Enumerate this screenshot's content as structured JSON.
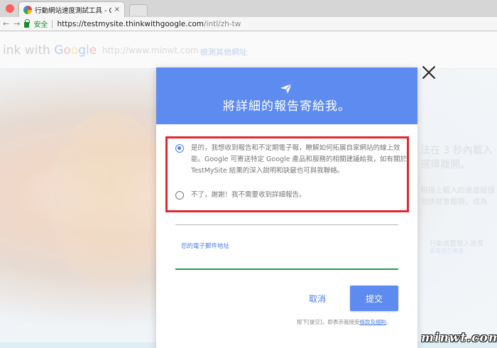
{
  "browser": {
    "tab_title": "行動網站速度測試工具 - Google",
    "tab_close": "×",
    "back": "←",
    "forward": "→",
    "secure_label": "安全",
    "url_host": "https://testmysite.thinkwithgoogle.com",
    "url_path": "/intl/zh-tw"
  },
  "page": {
    "brand_prefix": "ink with ",
    "brand_google": [
      "G",
      "o",
      "o",
      "g",
      "l",
      "e"
    ],
    "site_url": "http://www.minwt.com",
    "test_other": "檢測其他網址",
    "bg_lines": [
      "法在 3 秒內載入",
      "選擇離開。",
      "冊接上載入的速度緩慢",
      "很快就會離開，成為",
      "行動裝置載入速度",
      "看看修正建議"
    ]
  },
  "modal": {
    "title": "將詳細的報告寄給我。",
    "option_yes": "是的，我想收到報告和不定期電子報，瞭解如何拓展自家網站的線上效能。Google 可寄送特定 Google 產品和服務的相關建議給我，如有關於 TestMySite 結果的深入說明和訣竅也可與我聯絡。",
    "option_no": "不了，謝謝！我不需要收到詳細報告。",
    "selected_option": "yes",
    "email_label": "您的電子郵件地址",
    "email_value": "",
    "cancel_label": "取消",
    "submit_label": "提交",
    "footnote_prefix": "按下[提交]，即表示我接受",
    "footnote_link": "條款及細則",
    "footnote_suffix": "。"
  },
  "watermark": "minwt.com",
  "colors": {
    "accent": "#5e8bef",
    "highlight": "#e3262f",
    "focus_green": "#2c9a3f"
  }
}
